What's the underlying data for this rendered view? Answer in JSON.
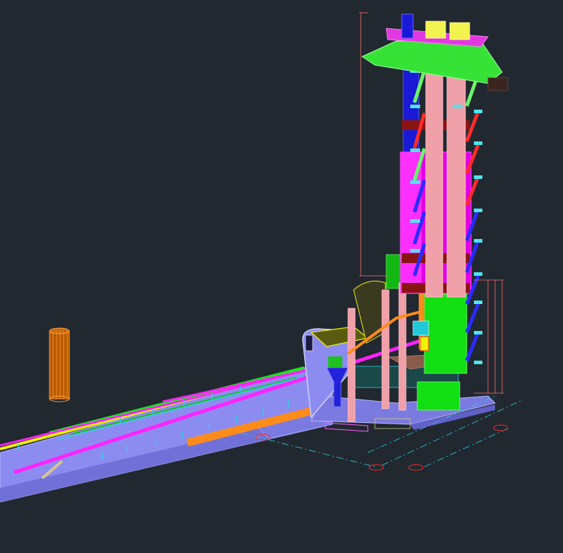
{
  "viewport": {
    "background": "#212830",
    "model": {
      "tower_colors": {
        "column_magenta": "#e100e1",
        "column_blue": "#1a1ad6",
        "column_pink": "#f0a0a8",
        "brace_green": "#6cf36c",
        "brace_red": "#ff2b2b",
        "bracket_cyan": "#4de6f0",
        "top_platform_green": "#37e237",
        "top_deck_magenta": "#e238e2",
        "head_yellow": "#f2f250"
      },
      "conveyor_colors": {
        "floor_purple": "#8c8cf0",
        "pipe_magenta": "#ff22ff",
        "pipe_orange": "#ff8c1a",
        "rail_green": "#18e818",
        "rail_yellow": "#f0f000"
      },
      "annotation_colors": {
        "dimension_line": "#ff7070",
        "grid_line": "#2fd0e0",
        "grid_bubble": "#ff2a2a"
      }
    }
  }
}
